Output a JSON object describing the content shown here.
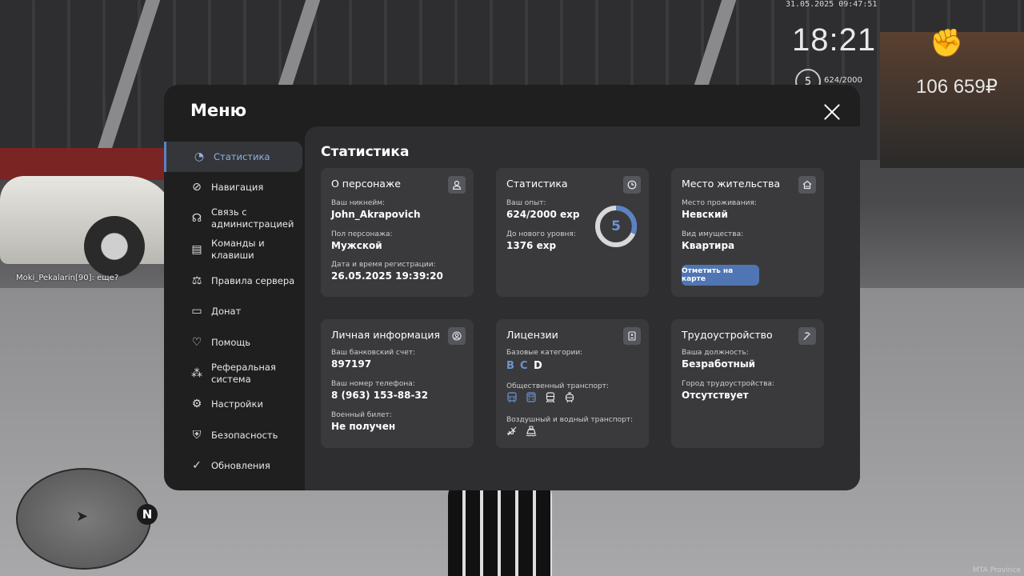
{
  "hud": {
    "datetime": "31.05.2025 09:47:51",
    "time": "18:21",
    "level": "5",
    "exp": "624/2000",
    "money": "106 659₽"
  },
  "chat": {
    "line": "Moki_Pekalarin[90]: еще?"
  },
  "minimap": {
    "north": "N"
  },
  "watermark": "MTA Province",
  "menu": {
    "title": "Меню",
    "nav": [
      {
        "label": "Статистика",
        "icon": "pie-chart-icon",
        "active": true
      },
      {
        "label": "Навигация",
        "icon": "compass-icon"
      },
      {
        "label": "Связь с администрацией",
        "icon": "headset-icon"
      },
      {
        "label": "Команды и клавиши",
        "icon": "document-icon"
      },
      {
        "label": "Правила сервера",
        "icon": "scales-icon"
      },
      {
        "label": "Донат",
        "icon": "wallet-icon"
      },
      {
        "label": "Помощь",
        "icon": "heart-hands-icon"
      },
      {
        "label": "Реферальная система",
        "icon": "network-icon"
      },
      {
        "label": "Настройки",
        "icon": "gear-icon"
      },
      {
        "label": "Безопасность",
        "icon": "shield-icon"
      },
      {
        "label": "Обновления",
        "icon": "check-circle-icon"
      }
    ]
  },
  "stats": {
    "title": "Статистика",
    "character": {
      "title": "О персонаже",
      "nick_label": "Ваш никнейм:",
      "nick": "John_Akrapovich",
      "gender_label": "Пол персонажа:",
      "gender": "Мужской",
      "reg_label": "Дата и время регистрации:",
      "reg": "26.05.2025 19:39:20"
    },
    "statistics": {
      "title": "Статистика",
      "exp_label": "Ваш опыт:",
      "exp": "624/2000 exp",
      "next_label": "До нового уровня:",
      "next": "1376 exp",
      "level": "5",
      "progress": 0.312
    },
    "residence": {
      "title": "Место жительства",
      "place_label": "Место проживания:",
      "place": "Невский",
      "type_label": "Вид имущества:",
      "type": "Квартира",
      "button": "Отметить на карте"
    },
    "personal": {
      "title": "Личная информация",
      "bank_label": "Ваш банковский счет:",
      "bank": "897197",
      "phone_label": "Ваш номер телефона:",
      "phone": "8 (963) 153-88-32",
      "military_label": "Военный билет:",
      "military": "Не получен"
    },
    "licenses": {
      "title": "Лицензии",
      "base_label": "Базовые категории:",
      "categories": [
        {
          "name": "B",
          "color": "#6f93cf"
        },
        {
          "name": "C",
          "color": "#6f93cf"
        },
        {
          "name": "D",
          "color": "#ffffff"
        }
      ],
      "public_label": "Общественный транспорт:",
      "air_label": "Воздушный и водный транспорт:"
    },
    "employment": {
      "title": "Трудоустройство",
      "position_label": "Ваша должность:",
      "position": "Безработный",
      "city_label": "Город трудоустройства:",
      "city": "Отсутствует"
    }
  },
  "colors": {
    "accent": "#5b83c4",
    "ring_bg": "#d8d8d8",
    "ring_fg": "#5b83c4"
  }
}
